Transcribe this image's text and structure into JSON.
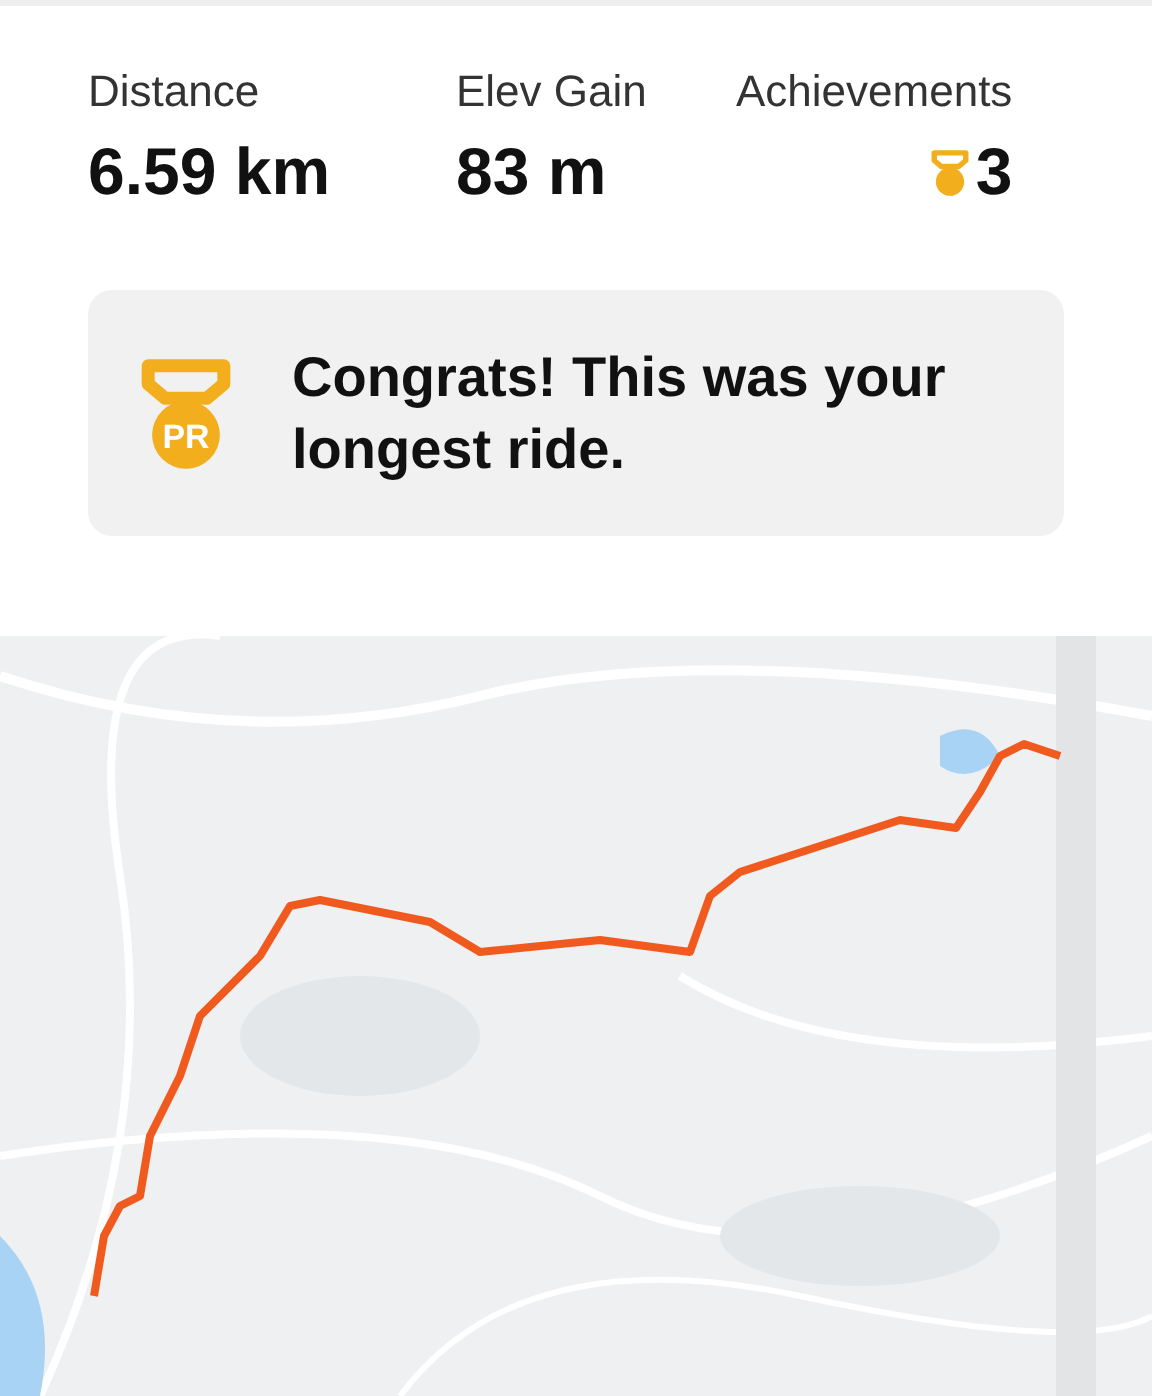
{
  "stats": [
    {
      "label": "Distance",
      "value": "6.59 km",
      "kind": "text"
    },
    {
      "label": "Elev Gain",
      "value": "83 m",
      "kind": "text"
    },
    {
      "label": "Achievements",
      "value": "3",
      "kind": "medal"
    }
  ],
  "congrats": {
    "badge": "PR",
    "message": "Congrats! This was your longest ride."
  }
}
